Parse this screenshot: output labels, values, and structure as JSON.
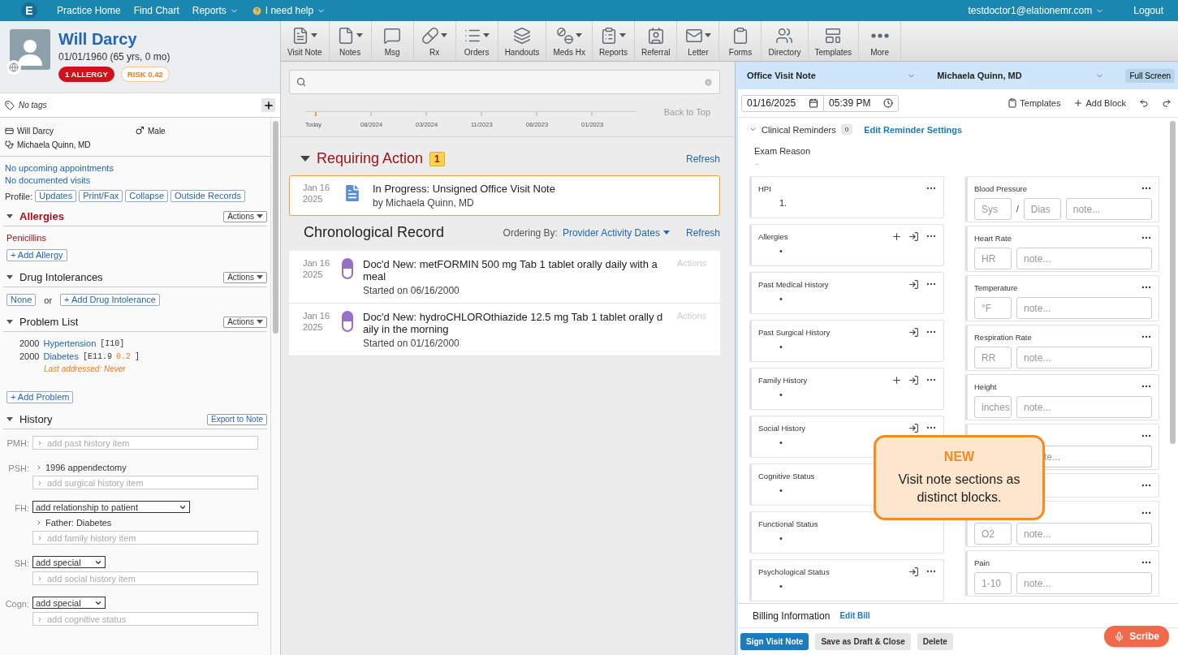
{
  "nav": {
    "logo": "E",
    "items": [
      {
        "label": "Practice Home",
        "dropdown": false,
        "kind": "link"
      },
      {
        "label": "Find Chart",
        "dropdown": false,
        "kind": "link"
      },
      {
        "label": "Reports",
        "dropdown": true,
        "kind": "link"
      },
      {
        "label": "I need help",
        "dropdown": true,
        "kind": "help"
      }
    ],
    "user": "testdoctor1@elationemr.com",
    "logout": "Logout"
  },
  "patient": {
    "name": "Will Darcy",
    "dob": "01/01/1960 (65 yrs, 0 mo)",
    "badges": [
      {
        "label": "1 ALLERGY",
        "kind": "alert"
      },
      {
        "label": "RISK 0.42",
        "kind": "risk"
      }
    ],
    "tags": "No tags",
    "demographics": {
      "name": "Will Darcy",
      "sex": "Male",
      "provider": "Michaela Quinn, MD"
    },
    "links": [
      "No upcoming appointments",
      "No documented visits"
    ],
    "profile": {
      "label": "Profile:",
      "buttons": [
        "Updates",
        "Print/Fax",
        "Collapse",
        "Outside Records"
      ]
    }
  },
  "sections": [
    {
      "kind": "allergies",
      "title": "Allergies",
      "alert": true,
      "expanded": true,
      "header_button": {
        "label": "Actions",
        "dropdown": true
      },
      "items": [
        "Penicillins"
      ],
      "add": "+ Add Allergy"
    },
    {
      "kind": "intolerances",
      "title": "Drug Intolerances",
      "alert": false,
      "expanded": true,
      "header_button": {
        "label": "Actions",
        "dropdown": true
      },
      "none": "None",
      "or": "or",
      "add": "+ Add Drug Intolerance"
    },
    {
      "kind": "problems",
      "title": "Problem List",
      "alert": false,
      "expanded": true,
      "header_button": {
        "label": "Actions",
        "dropdown": true
      },
      "problems": [
        {
          "year": "2000",
          "name": "Hypertension",
          "code": "[I10]"
        },
        {
          "year": "2000",
          "name": "Diabetes",
          "code": "[E11.9",
          "score": "0.2",
          "code_end": "]",
          "note": "Last addressed: Never"
        }
      ],
      "add": "+ Add Problem"
    },
    {
      "kind": "history",
      "title": "History",
      "alert": false,
      "expanded": true,
      "header_button": {
        "label": "Export to Note",
        "dropdown": false
      },
      "rows": [
        {
          "label": "PMH:",
          "placeholder": "add past history item"
        },
        {
          "label": "PSH:",
          "entries": [
            "1996 appendectomy"
          ],
          "placeholder": "add surgical history item"
        },
        {
          "label": "FH:",
          "select": "add relationship to patient",
          "entries": [
            "Father: Diabetes"
          ],
          "placeholder": "add family history item"
        },
        {
          "label": "SH:",
          "select": "add special",
          "placeholder": "add social history item"
        },
        {
          "label": "Cogn:",
          "select": "add special",
          "placeholder": "add cognitive status"
        }
      ]
    }
  ],
  "toolbar": [
    {
      "label": "Visit Note",
      "dropdown": true
    },
    {
      "label": "Notes",
      "dropdown": true
    },
    {
      "label": "Msg",
      "dropdown": false
    },
    {
      "label": "Rx",
      "dropdown": true
    },
    {
      "label": "Orders",
      "dropdown": true
    },
    {
      "label": "Handouts",
      "dropdown": false
    },
    {
      "label": "Meds Hx",
      "dropdown": true
    },
    {
      "label": "Reports",
      "dropdown": true
    },
    {
      "label": "Referral",
      "dropdown": false
    },
    {
      "label": "Letter",
      "dropdown": true
    },
    {
      "label": "Forms",
      "dropdown": false
    },
    {
      "label": "Directory",
      "dropdown": false
    },
    {
      "label": "Templates",
      "dropdown": false
    },
    {
      "label": "More",
      "dropdown": false
    }
  ],
  "timeline": {
    "ticks": [
      "Today",
      "08/2024",
      "03/2024",
      "11/2023",
      "06/2023",
      "01/2023"
    ],
    "back_to_top": "Back to Top"
  },
  "requiring": {
    "title": "Requiring Action",
    "count": "1",
    "refresh": "Refresh",
    "expanded": true,
    "items": [
      {
        "date": "Jan 16",
        "year": "2025",
        "title": "In Progress: Unsigned Office Visit Note",
        "subtitle": "by Michaela Quinn, MD"
      }
    ]
  },
  "chronological": {
    "title": "Chronological Record",
    "ordering_label": "Ordering By:",
    "ordering": "Provider Activity Dates",
    "refresh": "Refresh",
    "rows": [
      {
        "date": "Jan 16",
        "year": "2025",
        "title": "Doc'd New: metFORMIN 500 mg Tab 1 tablet orally daily with a meal",
        "subtitle": "Started on 06/16/2000",
        "actions": "Actions"
      },
      {
        "date": "Jan 16",
        "year": "2025",
        "title": "Doc'd New: hydroCHLOROthiazide 12.5 mg Tab 1 tablet orally daily in the morning",
        "subtitle": "Started on 01/16/2000",
        "actions": "Actions"
      }
    ]
  },
  "note": {
    "type": "Office Visit Note",
    "provider": "Michaela Quinn, MD",
    "full_screen": "Full Screen",
    "date": "01/16/2025",
    "time": "05:39 PM",
    "templates": "Templates",
    "add_block": "Add Block",
    "reminders": {
      "label": "Clinical Reminders",
      "count": "0",
      "link": "Edit Reminder Settings",
      "expanded": true
    },
    "exam_reason": {
      "label": "Exam Reason",
      "value": "-"
    },
    "blocks": [
      {
        "title": "HPI",
        "body": "1.",
        "more": true
      },
      {
        "title": "Allergies",
        "body": "•",
        "add": true,
        "import": true,
        "more": true
      },
      {
        "title": "Past Medical History",
        "body": "•",
        "import": true,
        "more": true
      },
      {
        "title": "Past Surgical History",
        "body": "•",
        "import": true,
        "more": true
      },
      {
        "title": "Family History",
        "body": "•",
        "add": true,
        "import": true,
        "more": true
      },
      {
        "title": "Social History",
        "body": "•",
        "import": true,
        "more": true
      },
      {
        "title": "Cognitive Status",
        "body": "•"
      },
      {
        "title": "Functional Status",
        "body": "•"
      },
      {
        "title": "Psychological Status",
        "body": "•",
        "import": true,
        "more": true
      }
    ],
    "vitals": [
      {
        "title": "Blood Pressure",
        "more": true,
        "fields": [
          {
            "kind": "short",
            "placeholder": "Sys"
          },
          {
            "kind": "separator",
            "text": "/"
          },
          {
            "kind": "short",
            "placeholder": "Dias"
          },
          {
            "kind": "note",
            "placeholder": "note..."
          }
        ]
      },
      {
        "title": "Heart Rate",
        "more": true,
        "fields": [
          {
            "kind": "short",
            "placeholder": "HR"
          },
          {
            "kind": "note",
            "placeholder": "note..."
          }
        ]
      },
      {
        "title": "Temperature",
        "more": true,
        "fields": [
          {
            "kind": "short",
            "placeholder": "°F"
          },
          {
            "kind": "note",
            "placeholder": "note..."
          }
        ]
      },
      {
        "title": "Respiration Rate",
        "more": true,
        "fields": [
          {
            "kind": "short",
            "placeholder": "RR"
          },
          {
            "kind": "note",
            "placeholder": "note..."
          }
        ]
      },
      {
        "title": "Height",
        "more": true,
        "fields": [
          {
            "kind": "short",
            "placeholder": "inches"
          },
          {
            "kind": "note",
            "placeholder": "note..."
          }
        ]
      },
      {
        "more": true,
        "fields": [
          {
            "kind": "partial",
            "placeholder": "te..."
          }
        ]
      },
      {
        "more": true
      },
      {
        "more": true,
        "fields": [
          {
            "kind": "short",
            "placeholder": "O2"
          },
          {
            "kind": "note",
            "placeholder": "note..."
          }
        ]
      },
      {
        "title": "Pain",
        "more": true,
        "fields": [
          {
            "kind": "short",
            "placeholder": "1-10"
          },
          {
            "kind": "note",
            "placeholder": "note..."
          }
        ]
      }
    ],
    "billing": {
      "label": "Billing Information",
      "link": "Edit Bill"
    },
    "buttons": [
      {
        "label": "Sign Visit Note",
        "kind": "primary"
      },
      {
        "label": "Save as Draft & Close",
        "kind": "secondary"
      },
      {
        "label": "Delete",
        "kind": "secondary"
      }
    ],
    "callout": {
      "title": "NEW",
      "text": "Visit note sections as distinct blocks."
    },
    "scribe": "Scribe"
  }
}
